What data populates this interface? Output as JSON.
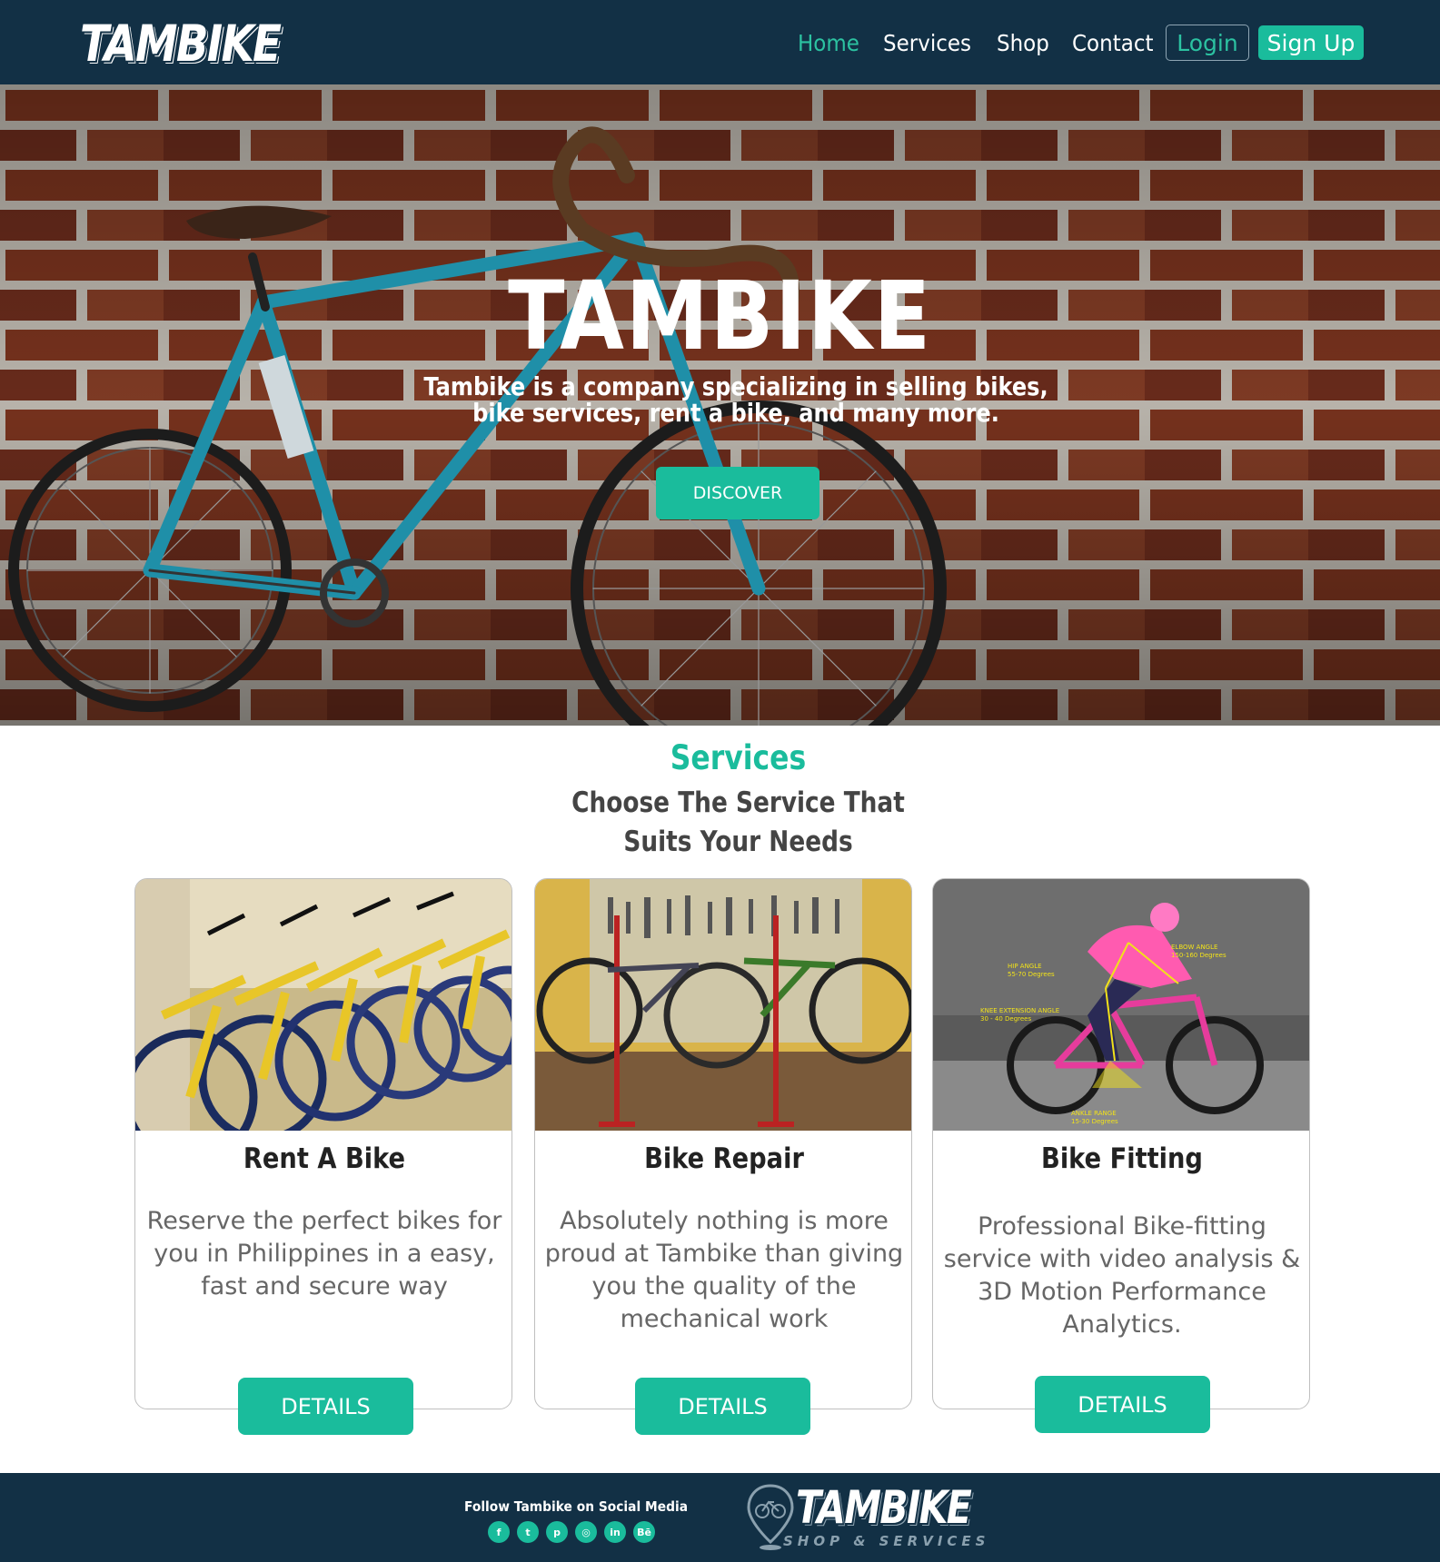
{
  "nav": {
    "logo": "TAMBIKE",
    "links": [
      "Home",
      "Services",
      "Shop",
      "Contact"
    ],
    "active": "Home",
    "login": "Login",
    "signup": "Sign Up"
  },
  "hero": {
    "title": "TAMBIKE",
    "subtitle": "Tambike is a company specializing in selling bikes, bike services, rent a bike, and many more.",
    "button": "DISCOVER"
  },
  "services": {
    "title": "Services",
    "subtitle_line1": "Choose The Service That",
    "subtitle_line2": "Suits Your Needs",
    "cards": [
      {
        "title": "Rent A Bike",
        "text": "Reserve the perfect bikes for you in Philippines in a easy, fast and secure way",
        "button": "DETAILS"
      },
      {
        "title": "Bike Repair",
        "text": "Absolutely nothing is more proud at Tambike than giving you the quality of the mechanical work",
        "button": "DETAILS"
      },
      {
        "title": "Bike Fitting",
        "text": "Professional Bike-fitting service with video analysis & 3D Motion Performance Analytics.",
        "button": "DETAILS"
      }
    ],
    "fitting_labels": {
      "hip": "HIP ANGLE",
      "hip_range": "55-70 Degrees",
      "elbow": "ELBOW ANGLE",
      "elbow_range": "150-160 Degrees",
      "knee": "KNEE EXTENSION ANGLE",
      "knee_range": "30 - 40 Degrees",
      "ankle": "ANKLE RANGE",
      "ankle_range": "15-30 Degrees"
    }
  },
  "footer": {
    "follow": "Follow Tambike on Social Media",
    "socials": [
      {
        "icon": "facebook-icon",
        "glyph": "f"
      },
      {
        "icon": "twitter-icon",
        "glyph": "t"
      },
      {
        "icon": "pinterest-icon",
        "glyph": "p"
      },
      {
        "icon": "instagram-icon",
        "glyph": "◎"
      },
      {
        "icon": "linkedin-icon",
        "glyph": "in"
      },
      {
        "icon": "behance-icon",
        "glyph": "Bē"
      }
    ],
    "logo": "TAMBIKE",
    "tagline": "SHOP & SERVICES"
  },
  "colors": {
    "navy": "#123045",
    "accent": "#1abc9c"
  }
}
